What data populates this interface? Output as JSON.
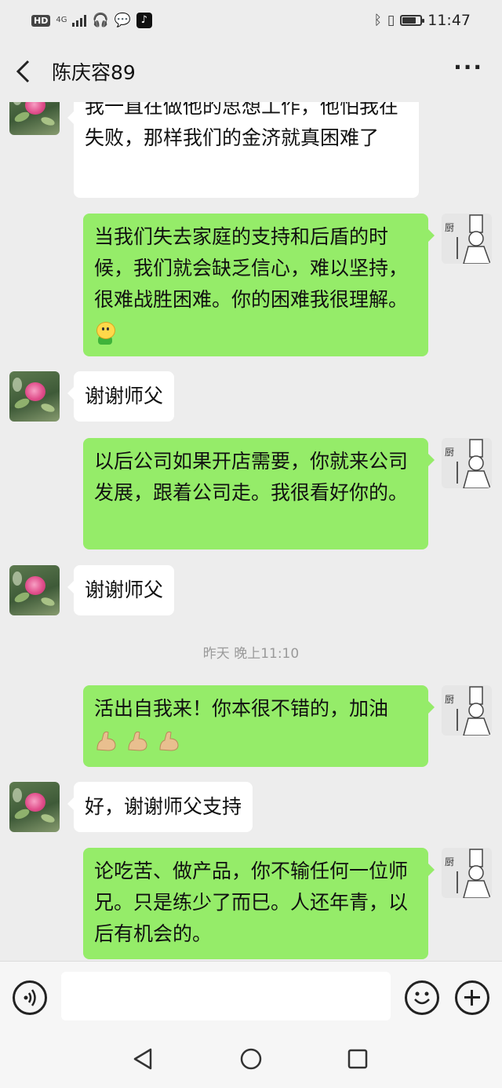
{
  "status_bar": {
    "hd_badge": "HD",
    "network": "4G",
    "time": "11:47",
    "battery_level": 0.7
  },
  "header": {
    "title": "陈庆容89"
  },
  "messages": [
    {
      "side": "left",
      "sender": "contact",
      "text": "我一直在做他的思想工作，他怕我在失败，那样我们的金济就真困难了"
    },
    {
      "side": "right",
      "sender": "self",
      "text": "当我们失去家庭的支持和后盾的时候，我们就会缺乏信心，难以坚持，很难战胜困难。你的困难我很理解。",
      "emoji": "smiley-sticker"
    },
    {
      "side": "left",
      "sender": "contact",
      "text": "谢谢师父"
    },
    {
      "side": "right",
      "sender": "self",
      "text": "以后公司如果开店需要，你就来公司发展，跟着公司走。我很看好你的。"
    },
    {
      "side": "left",
      "sender": "contact",
      "text": "谢谢师父"
    },
    {
      "side": "right",
      "sender": "self",
      "text": "活出自我来！你本很不错的，加油",
      "emoji": "flexed-biceps x3"
    },
    {
      "side": "left",
      "sender": "contact",
      "text": "好，谢谢师父支持"
    },
    {
      "side": "right",
      "sender": "self",
      "text": "论吃苦、做产品，你不输任何一位师兄。只是练少了而巳。人还年青，以后有机会的。"
    }
  ],
  "timestamp": "昨天 晚上11:10",
  "input_bar": {
    "voice_icon": "voice-icon",
    "input_value": "",
    "emoji_icon": "emoji-icon",
    "plus_icon": "plus-icon"
  },
  "colors": {
    "background": "#ededed",
    "self_bubble": "#95ec69",
    "contact_bubble": "#ffffff",
    "timestamp_text": "#9a9a9a"
  }
}
